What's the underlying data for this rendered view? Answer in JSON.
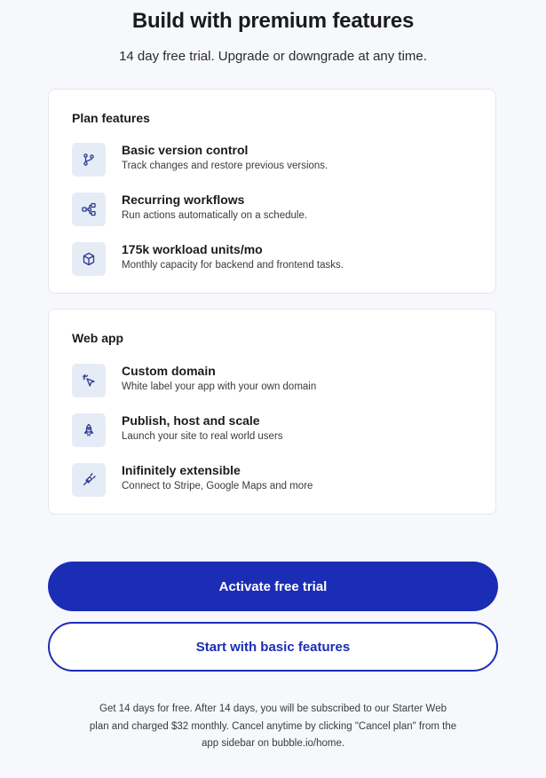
{
  "header": {
    "title": "Build with premium features",
    "subtitle": "14 day free trial. Upgrade or downgrade at any time."
  },
  "plan_features": {
    "title": "Plan features",
    "items": [
      {
        "icon": "git-branch-icon",
        "name": "Basic version control",
        "description": "Track changes and restore previous versions."
      },
      {
        "icon": "workflow-icon",
        "name": "Recurring workflows",
        "description": "Run actions automatically on a schedule."
      },
      {
        "icon": "cube-icon",
        "name": "175k workload units/mo",
        "description": "Monthly capacity for backend and frontend tasks."
      }
    ]
  },
  "web_app": {
    "title": "Web app",
    "items": [
      {
        "icon": "cursor-click-icon",
        "name": "Custom domain",
        "description": "White label your app with your own domain"
      },
      {
        "icon": "rocket-icon",
        "name": "Publish, host and scale",
        "description": "Launch your site to real world users"
      },
      {
        "icon": "plug-icon",
        "name": "Inifinitely extensible",
        "description": "Connect to Stripe, Google Maps and more"
      }
    ]
  },
  "buttons": {
    "activate_label": "Activate free trial",
    "basic_label": "Start with basic features"
  },
  "footnote": "Get 14 days for free. After 14 days, you will be subscribed to our Starter Web plan and charged $32 monthly. Cancel anytime by clicking \"Cancel plan\" from the app sidebar on bubble.io/home.",
  "colors": {
    "accent": "#1b2db5",
    "icon_bg": "#e6ecf6",
    "icon_stroke": "#2b3a8f"
  }
}
